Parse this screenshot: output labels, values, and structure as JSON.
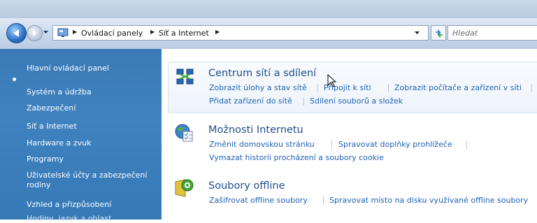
{
  "address": {
    "crumbs": [
      "Ovládací panely",
      "Síť a Internet"
    ],
    "search_placeholder": "Hledat"
  },
  "sidebar": {
    "items": [
      {
        "label": "Hlavní ovládací panel"
      },
      {
        "label": "Systém a údržba"
      },
      {
        "label": "Zabezpečení"
      },
      {
        "label": "Síť a Internet",
        "selected": true
      },
      {
        "label": "Hardware a zvuk"
      },
      {
        "label": "Programy"
      },
      {
        "label": "Uživatelské účty a zabezpečení rodiny"
      },
      {
        "label": "Vzhled a přizpůsobení"
      },
      {
        "label": "Hodiny, jazyk a oblast"
      }
    ]
  },
  "categories": [
    {
      "title": "Centrum sítí a sdílení",
      "icon": "network-center-icon",
      "links": [
        "Zobrazit úlohy a stav sítě",
        "Připojit k síti",
        "Zobrazit počítače a zařízení v síti",
        "Přidat zařízení do sítě",
        "Sdílení souborů a složek"
      ]
    },
    {
      "title": "Možnosti Internetu",
      "icon": "internet-options-icon",
      "links": [
        "Změnit domovskou stránku",
        "Spravovat doplňky prohlížeče",
        "Vymazat historii procházení a soubory cookie"
      ]
    },
    {
      "title": "Soubory offline",
      "icon": "offline-files-icon",
      "links": [
        "Zašifrovat offline soubory",
        "Spravovat místo na disku využívané offline soubory"
      ]
    }
  ]
}
